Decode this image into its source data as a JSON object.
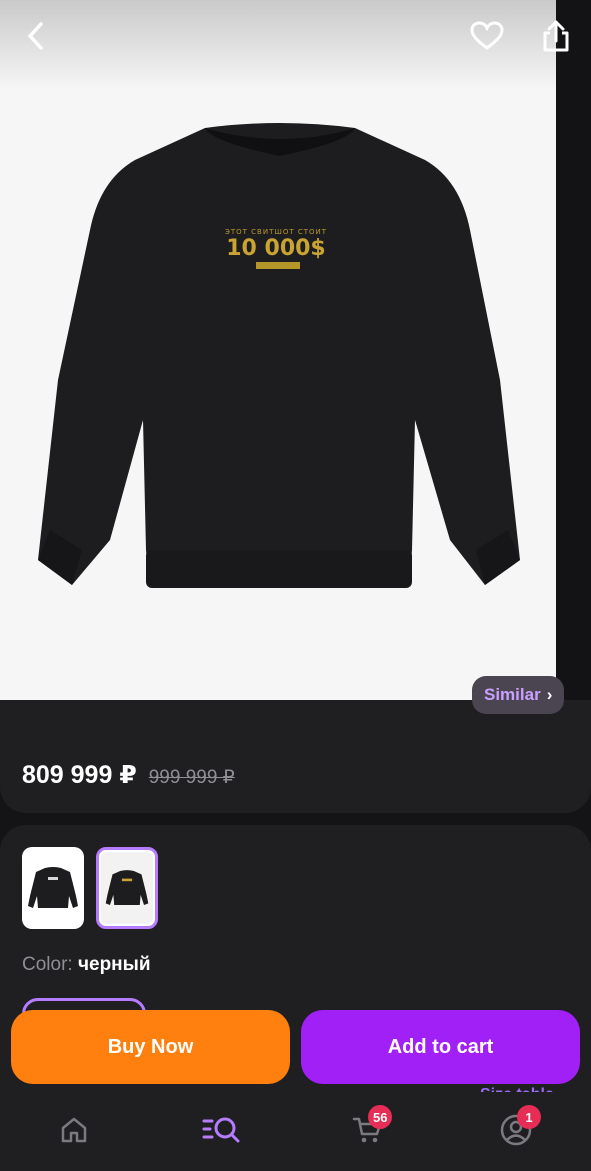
{
  "header": {
    "back_icon": "chevron-left-icon",
    "favorite_icon": "heart-outline-icon",
    "share_icon": "share-icon"
  },
  "product_image": {
    "print_line1": "ЭТОТ СВИТШОТ СТОИТ",
    "print_big": "10 000$"
  },
  "similar": {
    "label": "Similar",
    "chevron": "›"
  },
  "price": {
    "current": "809 999 ₽",
    "old": "999 999 ₽"
  },
  "variants": {
    "color_label": "Color:",
    "color_value": "черный",
    "selected_index": 1
  },
  "size_table_label": "Size table",
  "actions": {
    "buy_now": "Buy Now",
    "add_to_cart": "Add to cart"
  },
  "nav": {
    "items": [
      "home-icon",
      "catalog-search-icon",
      "cart-icon",
      "profile-icon"
    ],
    "active": "catalog-search-icon",
    "cart_badge": "56",
    "profile_badge": "1"
  },
  "colors": {
    "accent_purple": "#a020f5",
    "accent_orange": "#ff7f0f",
    "badge_red": "#e52d55",
    "background": "#141416",
    "card": "#1f1f22"
  }
}
